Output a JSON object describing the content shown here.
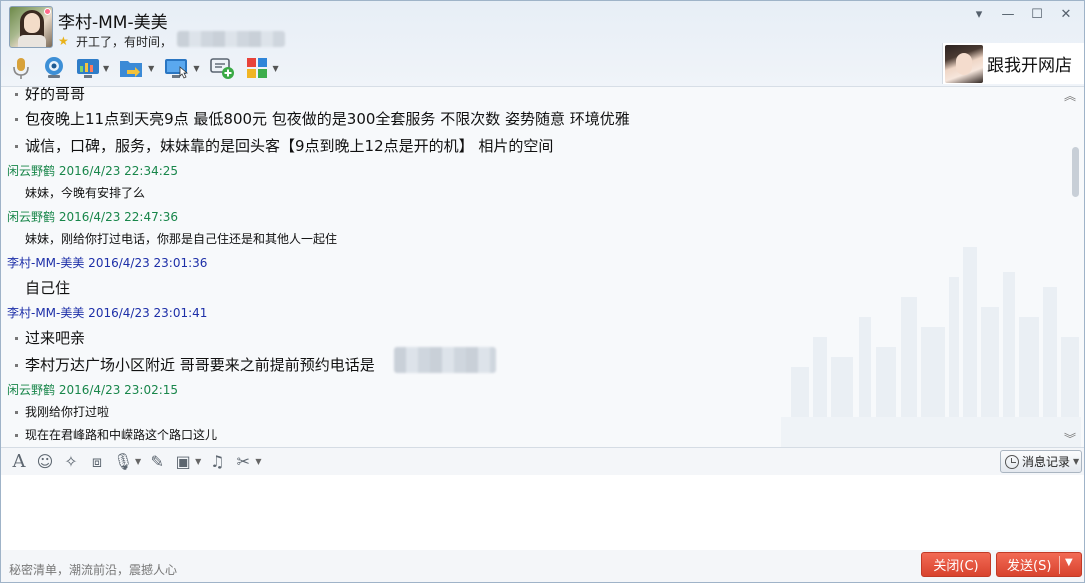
{
  "header": {
    "contact_name": "李村-MM-美美",
    "status_text": "开工了，有时间，",
    "ad_text": "跟我开网店"
  },
  "window_controls": {
    "dropdown": "▾",
    "minimize": "—",
    "maximize": "☐",
    "close": "✕"
  },
  "toolbar_icons": [
    "microphone-icon",
    "webcam-icon",
    "screen-share-icon",
    "file-transfer-icon",
    "remote-assist-icon",
    "add-group-chat-icon",
    "apps-icon"
  ],
  "chat": {
    "messages": [
      {
        "type": "line",
        "size": "big",
        "text": "好的哥哥"
      },
      {
        "type": "line",
        "size": "big",
        "text": "包夜晚上11点到天亮9点 最低800元 包夜做的是300全套服务 不限次数 姿势随意 环境优雅"
      },
      {
        "type": "line",
        "size": "big",
        "text": "诚信，口碑，服务，妹妹靠的是回头客【9点到晚上12点是开的机】 相片的空间"
      },
      {
        "type": "head",
        "color": "green",
        "text": "闲云野鹤  2016/4/23 22:34:25"
      },
      {
        "type": "line",
        "size": "small",
        "text": "妹妹，今晚有安排了么"
      },
      {
        "type": "head",
        "color": "green",
        "text": "闲云野鹤  2016/4/23 22:47:36"
      },
      {
        "type": "line",
        "size": "small",
        "text": "妹妹，刚给你打过电话，你那是自己住还是和其他人一起住"
      },
      {
        "type": "head",
        "color": "blue",
        "text": "李村-MM-美美  2016/4/23 23:01:36"
      },
      {
        "type": "line",
        "size": "big",
        "text": "自己住"
      },
      {
        "type": "head",
        "color": "blue",
        "text": "李村-MM-美美  2016/4/23 23:01:41"
      },
      {
        "type": "line",
        "size": "big",
        "text": "过来吧亲"
      },
      {
        "type": "line",
        "size": "big",
        "text": "李村万达广场小区附近 哥哥要来之前提前预约电话是"
      },
      {
        "type": "head",
        "color": "green",
        "text": "闲云野鹤  2016/4/23 23:02:15"
      },
      {
        "type": "line",
        "size": "small",
        "text": "我刚给你打过啦"
      },
      {
        "type": "line",
        "size": "small",
        "text": "现在在君峰路和中嵘路这个路口这儿"
      }
    ]
  },
  "input_toolbar": {
    "icons": [
      "font-icon",
      "emoji-icon",
      "magic-icon",
      "screenshot-icon",
      "voice-icon",
      "edit-icon",
      "image-icon",
      "music-icon",
      "scissors-icon"
    ],
    "history_label": "消息记录"
  },
  "footer": {
    "slogan": "秘密清单，潮流前沿，震撼人心",
    "close_label": "关闭(C)",
    "send_label": "发送(S)"
  },
  "colors": {
    "accent_red": "#e4533d",
    "sender_green": "#18864a",
    "sender_blue": "#1d2fa8"
  }
}
